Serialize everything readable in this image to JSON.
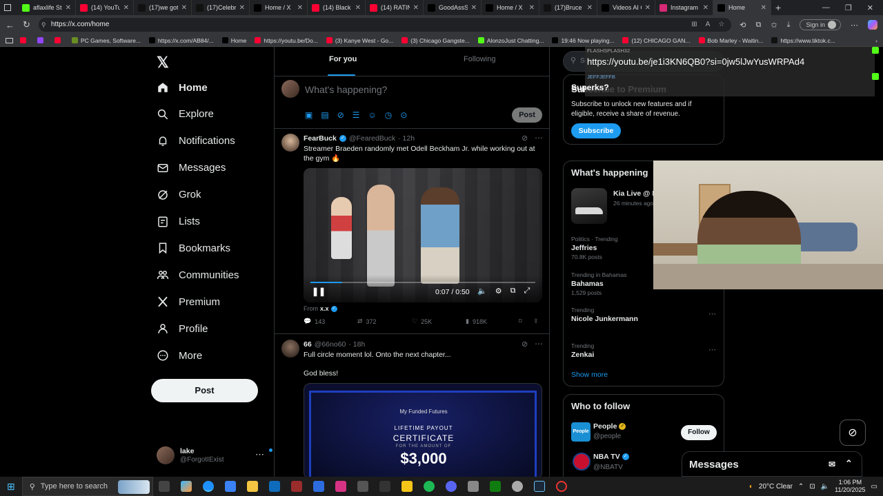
{
  "browser": {
    "tabs": [
      {
        "title": "aflaxlife Stre",
        "color": "#53fc18",
        "active": false
      },
      {
        "title": "(14) YouTub",
        "color": "#ff0033",
        "active": false
      },
      {
        "title": "(17)we got r",
        "color": "#111111",
        "active": false
      },
      {
        "title": "(17)Celebrat",
        "color": "#111111",
        "active": false
      },
      {
        "title": "Home / X",
        "color": "#000000",
        "active": false
      },
      {
        "title": "(14) Black C",
        "color": "#ff0033",
        "active": false
      },
      {
        "title": "(14) RATING",
        "color": "#ff0033",
        "active": false
      },
      {
        "title": "GoodAssSul",
        "color": "#000000",
        "active": false
      },
      {
        "title": "Home / X",
        "color": "#000000",
        "active": false
      },
      {
        "title": "(17)Bruce D",
        "color": "#111111",
        "active": false
      },
      {
        "title": "Videos AI C",
        "color": "#000000",
        "active": false
      },
      {
        "title": "Instagram",
        "color": "#d62976",
        "active": false
      },
      {
        "title": "Home",
        "color": "#000000",
        "active": true
      }
    ],
    "url": "https://x.com/home",
    "sign_in": "Sign in",
    "bookmarks": [
      {
        "label": "",
        "color": "#ff0033"
      },
      {
        "label": "",
        "color": "#9146ff"
      },
      {
        "label": "",
        "color": "#ff0033"
      },
      {
        "label": "PC Games, Software...",
        "color": "#6b8e23"
      },
      {
        "label": "https://x.com/AB84/...",
        "color": "#000000"
      },
      {
        "label": "Home",
        "color": "#000000"
      },
      {
        "label": "https://youtu.be/Do...",
        "color": "#ff0033"
      },
      {
        "label": "(3) Kanye West - Go...",
        "color": "#ff0033"
      },
      {
        "label": "(3) Chicago Gangste...",
        "color": "#ff0033"
      },
      {
        "label": "AlonzoJust Chatting...",
        "color": "#53fc18"
      },
      {
        "label": "19:46 Now playing...",
        "color": "#000000"
      },
      {
        "label": "(12) CHICAGO GAN...",
        "color": "#ff0033"
      },
      {
        "label": "Bob Marley - Waitin...",
        "color": "#ff0033"
      },
      {
        "label": "https://www.tiktok.c...",
        "color": "#111111"
      }
    ]
  },
  "sidebar": {
    "items": [
      {
        "label": "Home",
        "icon": "home-icon"
      },
      {
        "label": "Explore",
        "icon": "search-icon"
      },
      {
        "label": "Notifications",
        "icon": "bell-icon"
      },
      {
        "label": "Messages",
        "icon": "mail-icon"
      },
      {
        "label": "Grok",
        "icon": "grok-icon"
      },
      {
        "label": "Lists",
        "icon": "list-icon"
      },
      {
        "label": "Bookmarks",
        "icon": "bookmark-icon"
      },
      {
        "label": "Communities",
        "icon": "people-icon"
      },
      {
        "label": "Premium",
        "icon": "x-logo-icon"
      },
      {
        "label": "Profile",
        "icon": "person-icon"
      },
      {
        "label": "More",
        "icon": "more-circle-icon"
      }
    ],
    "post_label": "Post",
    "account": {
      "name": "lake",
      "handle": "@ForgotIExist"
    }
  },
  "feed": {
    "tabs": [
      "For you",
      "Following"
    ],
    "composer_placeholder": "What's happening?",
    "composer_post": "Post",
    "post1": {
      "name": "FearBuck",
      "handle": "@FearedBuck",
      "time": "· 12h",
      "text": "Streamer Braeden randomly met Odell Beckham Jr. while working out at the gym 🔥",
      "video_time": "0:07 / 0:50",
      "from_label": "From",
      "from_name": "x.x",
      "replies": "143",
      "reposts": "372",
      "likes": "25K",
      "views": "918K"
    },
    "post2": {
      "name": "66",
      "handle": "@66no60",
      "time": "· 18h",
      "text": "Full circle moment lol. Onto the next chapter...",
      "text2": "God bless!",
      "cert_brand": "My Funded Futures",
      "cert_title": "LIFETIME PAYOUT",
      "cert_sub": "CERTIFICATE",
      "cert_for": "FOR THE AMOUNT OF",
      "cert_amount": "$3,000"
    }
  },
  "right": {
    "search_placeholder": "Search",
    "premium": {
      "title": "Subscribe to Premium",
      "text": "Subscribe to unlock new features and if eligible, receive a share of revenue.",
      "button": "Subscribe"
    },
    "happening": {
      "title": "What's happening",
      "live_title": "Kia Live @ LA",
      "live_time": "26 minutes ago",
      "trends": [
        {
          "ctx": "Politics · Trending",
          "name": "Jeffries",
          "posts": "70.8K posts"
        },
        {
          "ctx": "Trending in Bahamas",
          "name": "Bahamas",
          "posts": "1,529 posts"
        },
        {
          "ctx": "Trending",
          "name": "Nicole Junkermann",
          "posts": ""
        },
        {
          "ctx": "Trending",
          "name": "Zenkai",
          "posts": ""
        }
      ],
      "show_more": "Show more"
    },
    "follow": {
      "title": "Who to follow",
      "accounts": [
        {
          "name": "People",
          "handle": "@people",
          "button": "Follow"
        },
        {
          "name": "NBA TV",
          "handle": "@NBATV",
          "button": ""
        }
      ]
    }
  },
  "messages_drawer": {
    "title": "Messages"
  },
  "chat_overlay": {
    "user1": "FLASHSPLASH32",
    "msg1": "https://youtu.be/je1i3KN6QB0?si=0jw5lJwYusWRPAd4",
    "user2": "JEFFJEFFB",
    "msg2": "Superks?"
  },
  "taskbar": {
    "search_placeholder": "Type here to search",
    "weather": "20°C  Clear",
    "time": "1:06 PM",
    "date": "11/20/2025"
  },
  "colors": {
    "accent": "#1d9bf0",
    "verified": "#1d9bf0",
    "gold": "#e2b719"
  }
}
